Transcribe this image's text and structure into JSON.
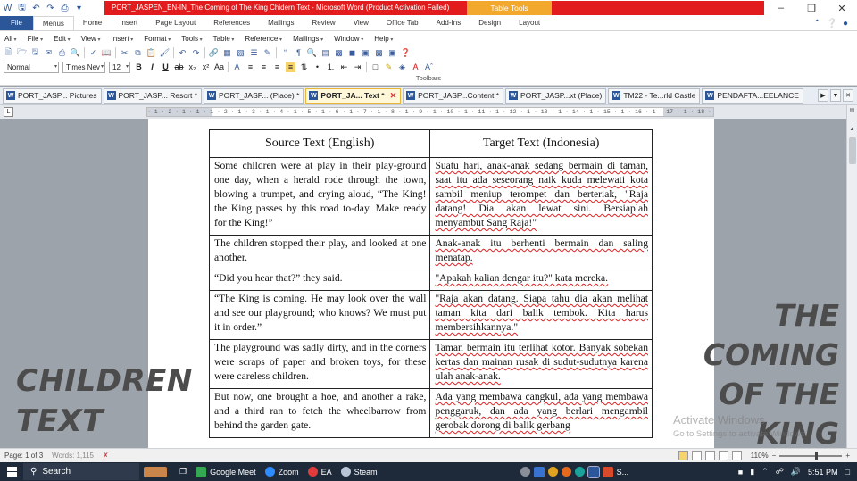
{
  "title_bar": {
    "document_title": "PORT_JASPEN_EN-IN_The Coming of The King Chidern Text  -  Microsoft Word (Product Activation Failed)",
    "context_tab": "Table Tools"
  },
  "ribbon_tabs": [
    "File",
    "Menus",
    "Home",
    "Insert",
    "Page Layout",
    "References",
    "Mailings",
    "Review",
    "View",
    "Office Tab",
    "Add-Ins",
    "Design",
    "Layout"
  ],
  "menu_items": [
    "All",
    "File",
    "Edit",
    "View",
    "Insert",
    "Format",
    "Tools",
    "Table",
    "Reference",
    "Mailings",
    "Window",
    "Help"
  ],
  "toolbar": {
    "style_value": "Normal",
    "font_value": "Times Nev",
    "size_value": "12",
    "label": "Toolbars"
  },
  "doc_tabs": [
    {
      "label": "PORT_JASP... Pictures",
      "active": false
    },
    {
      "label": "PORT_JASP... Resort *",
      "active": false
    },
    {
      "label": "PORT_JASP... (Place) *",
      "active": false
    },
    {
      "label": "PORT_JA... Text *",
      "active": true
    },
    {
      "label": "PORT_JASP...Content *",
      "active": false
    },
    {
      "label": "PORT_JASP...xt (Place)",
      "active": false
    },
    {
      "label": "TM22 - Te...rld Castle",
      "active": false
    },
    {
      "label": "PENDAFTA...EELANCE",
      "active": false
    }
  ],
  "ruler_text": "· 1 · 2 · 1 · 1 · 1 · 2 · 1 · 3 · 1 · 4 · 1 · 5 · 1 · 6 · 1 · 7 · 1 · 8 · 1 · 9 · 1 · 10 · 1 · 11 · 1 · 12 · 1 · 13 · 1 · 14 · 1 · 15 · 1 · 16 · 1 · 17 · 1 · 18 ·",
  "table": {
    "headers": [
      "Source Text (English)",
      "Target Text (Indonesia)"
    ],
    "rows": [
      [
        "Some children were at play in their play-ground one day, when a herald rode through the town, blowing a trumpet, and crying aloud, “The King! the King passes by this road to-day. Make ready for the King!”",
        "Suatu hari, anak-anak sedang bermain di taman, saat itu ada seseorang naik kuda melewati kota sambil meniup terompet dan berteriak, \"Raja datang! Dia akan lewat sini. Bersiaplah menyambut Sang Raja!\""
      ],
      [
        "The children stopped their play, and looked at one another.",
        "Anak-anak itu berhenti bermain dan saling menatap."
      ],
      [
        "“Did you hear that?” they said.",
        "\"Apakah kalian dengar itu?\" kata mereka."
      ],
      [
        "“The King is coming. He may look over the wall and see our playground; who knows? We must put it in order.”",
        "\"Raja akan datang. Siapa tahu dia akan melihat taman kita dari balik tembok. Kita harus membersihkannya.\""
      ],
      [
        "The playground was sadly dirty, and in the corners were scraps of paper and broken toys, for these were careless children.",
        "Taman bermain itu terlihat kotor. Banyak sobekan kertas dan mainan rusak di sudut-sudutnya karena ulah anak-anak."
      ],
      [
        "But now, one brought a hoe, and another a rake, and a third ran to fetch the wheelbarrow from behind the garden gate.",
        "Ada yang membawa cangkul, ada yang membawa penggaruk, dan ada yang berlari mengambil gerobak dorong di balik gerbang"
      ]
    ]
  },
  "overlay": {
    "left_lines": [
      "CHILDREN",
      "TEXT"
    ],
    "right_lines": [
      "THE",
      "COMING",
      "OF THE",
      "KING"
    ],
    "activate_title": "Activate Windows",
    "activate_sub": "Go to Settings to activate Windows."
  },
  "status": {
    "page": "Page: 1 of 3",
    "words": "Words: 1,115",
    "zoom": "110%"
  },
  "taskbar": {
    "search": "Search",
    "apps": [
      "Google Meet",
      "Zoom",
      "EA",
      "Steam"
    ],
    "s_label": "S...",
    "time": "5:51 PM"
  }
}
